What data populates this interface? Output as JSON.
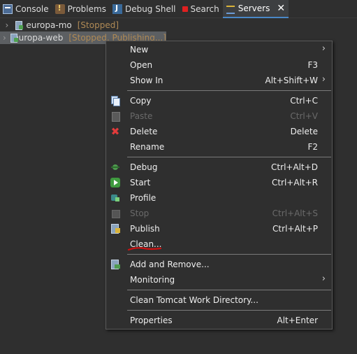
{
  "tabs": [
    {
      "label": "Console",
      "icon": "console-icon"
    },
    {
      "label": "Problems",
      "icon": "problems-icon"
    },
    {
      "label": "Debug Shell",
      "icon": "debug-shell-icon"
    },
    {
      "label": "Search",
      "icon": "search-icon"
    },
    {
      "label": "Servers",
      "icon": "servers-icon",
      "active": true
    }
  ],
  "tab_close": "✕",
  "servers": [
    {
      "name": "europa-mo",
      "status": "[Stopped]"
    },
    {
      "name": "europa-web",
      "status": "[Stopped, Publishing...]"
    }
  ],
  "menu": {
    "new": {
      "label": "New"
    },
    "open": {
      "label": "Open",
      "accel": "F3"
    },
    "show_in": {
      "label": "Show In",
      "accel": "Alt+Shift+W"
    },
    "copy": {
      "label": "Copy",
      "accel": "Ctrl+C"
    },
    "paste": {
      "label": "Paste",
      "accel": "Ctrl+V"
    },
    "delete": {
      "label": "Delete",
      "accel": "Delete"
    },
    "rename": {
      "label": "Rename",
      "accel": "F2"
    },
    "debug": {
      "label": "Debug",
      "accel": "Ctrl+Alt+D"
    },
    "start": {
      "label": "Start",
      "accel": "Ctrl+Alt+R"
    },
    "profile": {
      "label": "Profile"
    },
    "stop": {
      "label": "Stop",
      "accel": "Ctrl+Alt+S"
    },
    "publish": {
      "label": "Publish",
      "accel": "Ctrl+Alt+P"
    },
    "clean": {
      "label": "Clean..."
    },
    "add_remove": {
      "label": "Add and Remove..."
    },
    "monitoring": {
      "label": "Monitoring"
    },
    "clean_tomcat": {
      "label": "Clean Tomcat Work Directory..."
    },
    "properties": {
      "label": "Properties",
      "accel": "Alt+Enter"
    }
  },
  "colors": {
    "background": "#2f2f2f",
    "active_tab_underline": "#4a88c7",
    "status_text": "#b08a55",
    "annotation": "#d01010"
  }
}
